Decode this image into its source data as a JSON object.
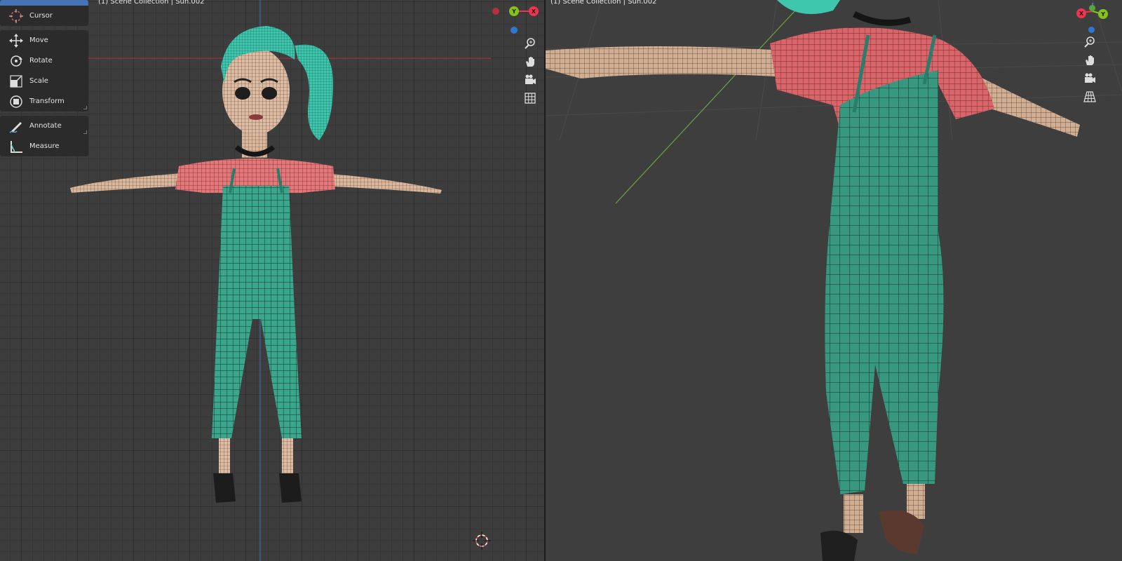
{
  "left_viewport": {
    "header": "(1) Scene Collection | Sun.002"
  },
  "right_viewport": {
    "header": "(1) Scene Collection | Sun.002"
  },
  "toolbar": {
    "groups": [
      [
        {
          "label": "Cursor",
          "icon": "cursor-icon"
        }
      ],
      [
        {
          "label": "Move",
          "icon": "move-icon"
        },
        {
          "label": "Rotate",
          "icon": "rotate-icon"
        },
        {
          "label": "Scale",
          "icon": "scale-icon"
        },
        {
          "label": "Transform",
          "icon": "transform-icon"
        }
      ],
      [
        {
          "label": "Annotate",
          "icon": "annotate-icon"
        },
        {
          "label": "Measure",
          "icon": "measure-icon"
        }
      ]
    ]
  },
  "gizmo": {
    "x_label": "X",
    "y_label": "Y",
    "colors": {
      "x": "#f0344f",
      "y": "#84c31a",
      "z": "#2f77d1",
      "accent": "#4772b3"
    }
  },
  "navigation_icons": [
    "zoom-icon",
    "pan-hand-icon",
    "camera-icon",
    "grid-perspective-icon"
  ]
}
